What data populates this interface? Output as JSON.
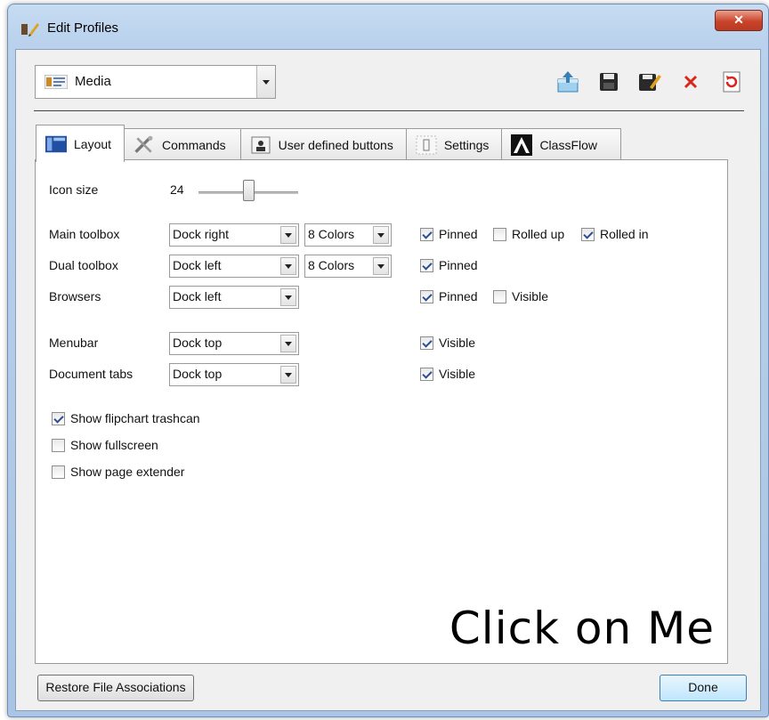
{
  "window": {
    "title": "Edit Profiles",
    "close_label": "✕"
  },
  "profile": {
    "selected": "Media"
  },
  "toolbar": {
    "icons": [
      "export-icon",
      "save-icon",
      "save-as-icon",
      "delete-icon",
      "reset-icon"
    ]
  },
  "tabs": [
    {
      "label": "Layout",
      "icon": "layout-icon",
      "active": true
    },
    {
      "label": "Commands",
      "icon": "tools-icon",
      "active": false
    },
    {
      "label": "User defined buttons",
      "icon": "user-icon",
      "active": false
    },
    {
      "label": "Settings",
      "icon": "settings-icon",
      "active": false
    },
    {
      "label": "ClassFlow",
      "icon": "classflow-icon",
      "active": false
    }
  ],
  "layout": {
    "icon_size": {
      "label": "Icon size",
      "value": "24"
    },
    "main_toolbox": {
      "label": "Main toolbox",
      "dock": "Dock right",
      "colors": "8 Colors",
      "pinned": "Pinned",
      "pinned_checked": true,
      "rolled_up": "Rolled up",
      "rolled_up_checked": false,
      "rolled_in": "Rolled in",
      "rolled_in_checked": true
    },
    "dual_toolbox": {
      "label": "Dual toolbox",
      "dock": "Dock left",
      "colors": "8 Colors",
      "pinned": "Pinned",
      "pinned_checked": true
    },
    "browsers": {
      "label": "Browsers",
      "dock": "Dock left",
      "pinned": "Pinned",
      "pinned_checked": true,
      "visible": "Visible",
      "visible_checked": false
    },
    "menubar": {
      "label": "Menubar",
      "dock": "Dock top",
      "visible": "Visible",
      "visible_checked": true
    },
    "document_tabs": {
      "label": "Document tabs",
      "dock": "Dock top",
      "visible": "Visible",
      "visible_checked": true
    },
    "show_trashcan": {
      "label": "Show flipchart trashcan",
      "checked": true
    },
    "show_fullscreen": {
      "label": "Show fullscreen",
      "checked": false
    },
    "show_page_extender": {
      "label": "Show page extender",
      "checked": false
    }
  },
  "overlay_text": "Click on Me",
  "buttons": {
    "restore": "Restore File Associations",
    "done": "Done"
  }
}
